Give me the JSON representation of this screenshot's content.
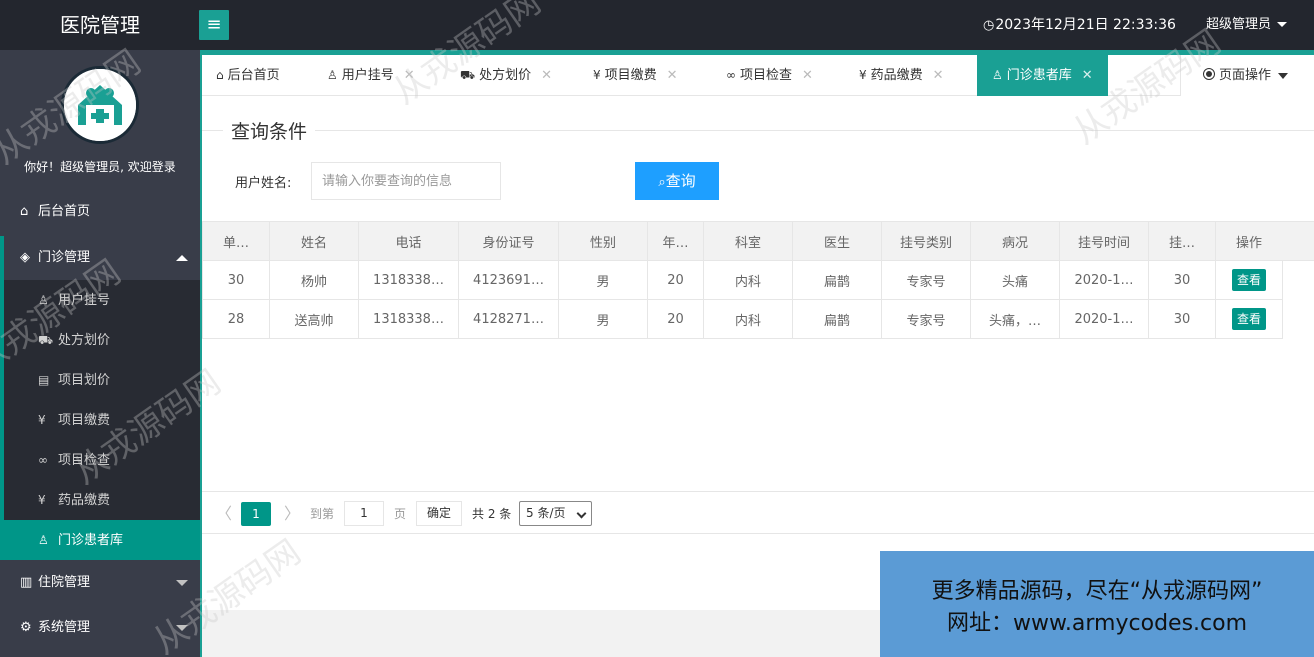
{
  "app": {
    "title": "医院管理",
    "menu_toggle_glyph": "≡",
    "clock": "2023年12月21日 22:33:36",
    "user": "超级管理员"
  },
  "sidebar": {
    "welcome": "你好！超级管理员, 欢迎登录",
    "items": [
      {
        "label": "后台首页",
        "icon": "home-icon",
        "glyph": "⌂"
      },
      {
        "label": "门诊管理",
        "icon": "grid-icon",
        "glyph": "◈"
      },
      {
        "label": "住院管理",
        "icon": "building-icon",
        "glyph": "▥"
      },
      {
        "label": "系统管理",
        "icon": "gear-icon",
        "glyph": "⚙"
      }
    ],
    "subitems": [
      {
        "label": "用户挂号",
        "icon": "user-icon",
        "glyph": "♙"
      },
      {
        "label": "处方划价",
        "icon": "cart-icon",
        "glyph": "⛟"
      },
      {
        "label": "项目划价",
        "icon": "document-icon",
        "glyph": "▤"
      },
      {
        "label": "项目缴费",
        "icon": "yen-icon",
        "glyph": "¥"
      },
      {
        "label": "项目检查",
        "icon": "link-icon",
        "glyph": "∞"
      },
      {
        "label": "药品缴费",
        "icon": "yen-icon",
        "glyph": "¥"
      },
      {
        "label": "门诊患者库",
        "icon": "user-icon",
        "glyph": "♙"
      }
    ]
  },
  "tabs": [
    {
      "label": "后台首页",
      "glyph": "⌂"
    },
    {
      "label": "用户挂号",
      "glyph": "♙"
    },
    {
      "label": "处方划价",
      "glyph": "⛟"
    },
    {
      "label": "项目缴费",
      "glyph": "¥"
    },
    {
      "label": "项目检查",
      "glyph": "∞"
    },
    {
      "label": "药品缴费",
      "glyph": "¥"
    },
    {
      "label": "门诊患者库",
      "glyph": "♙"
    }
  ],
  "tab_close_glyph": "✕",
  "page_op": "页面操作",
  "query": {
    "legend": "查询条件",
    "label": "用户姓名:",
    "placeholder": "请输入你要查询的信息",
    "value": "",
    "button": "查询",
    "button_glyph": "🔍"
  },
  "table": {
    "columns": [
      "单…",
      "姓名",
      "电话",
      "身份证号",
      "性别",
      "年…",
      "科室",
      "医生",
      "挂号类别",
      "病况",
      "挂号时间",
      "挂…",
      "操作"
    ],
    "rows": [
      [
        "30",
        "杨帅",
        "1318338…",
        "4123691…",
        "男",
        "20",
        "内科",
        "扁鹊",
        "专家号",
        "头痛",
        "2020-1…",
        "30"
      ],
      [
        "28",
        "送高帅",
        "1318338…",
        "4128271…",
        "男",
        "20",
        "内科",
        "扁鹊",
        "专家号",
        "头痛，…",
        "2020-1…",
        "30"
      ]
    ],
    "action_label": "查看"
  },
  "pager": {
    "prev": "〈",
    "current": "1",
    "next": "〉",
    "goto_label": "到第",
    "goto_value": "1",
    "page_label": "页",
    "ok": "确定",
    "total": "共 2 条",
    "page_size": "5 条/页"
  },
  "ad": {
    "line1": "更多精品源码，尽在“从戎源码网”",
    "line2": "网址：www.armycodes.com"
  },
  "watermark": "从戎源码网",
  "colors": {
    "teal": "#009688",
    "teal_light": "#1aa094",
    "blue": "#1e9fff",
    "dark": "#23262e",
    "sidebar": "#393d49"
  }
}
